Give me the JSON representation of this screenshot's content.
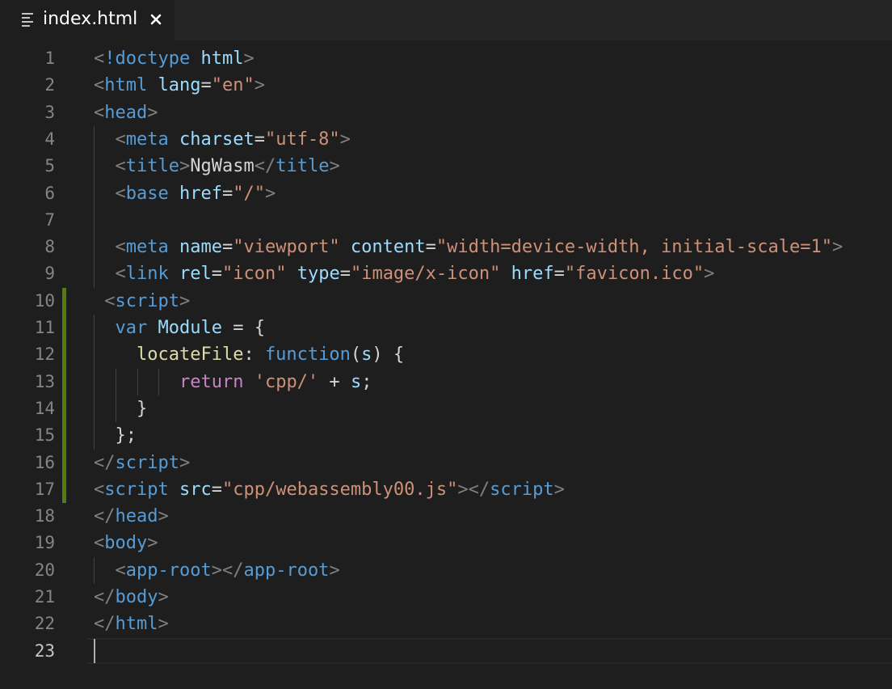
{
  "tab": {
    "label": "index.html",
    "icon": "lines-file-icon",
    "close_icon": "close-icon"
  },
  "editor": {
    "active_line": 23,
    "modified_lines": [
      10,
      11,
      12,
      13,
      14,
      15,
      16,
      17
    ],
    "lines": [
      {
        "num": "1",
        "tokens": [
          {
            "c": "punct",
            "t": "<"
          },
          {
            "c": "tag",
            "t": "!doctype"
          },
          {
            "c": "txt",
            "t": " "
          },
          {
            "c": "attr",
            "t": "html"
          },
          {
            "c": "punct",
            "t": ">"
          }
        ]
      },
      {
        "num": "2",
        "tokens": [
          {
            "c": "punct",
            "t": "<"
          },
          {
            "c": "tag",
            "t": "html"
          },
          {
            "c": "txt",
            "t": " "
          },
          {
            "c": "attr",
            "t": "lang"
          },
          {
            "c": "txt",
            "t": "="
          },
          {
            "c": "str",
            "t": "\"en\""
          },
          {
            "c": "punct",
            "t": ">"
          }
        ]
      },
      {
        "num": "3",
        "tokens": [
          {
            "c": "punct",
            "t": "<"
          },
          {
            "c": "tag",
            "t": "head"
          },
          {
            "c": "punct",
            "t": ">"
          }
        ]
      },
      {
        "num": "4",
        "tokens": [
          {
            "c": "txt",
            "t": "  "
          },
          {
            "c": "punct",
            "t": "<"
          },
          {
            "c": "tag",
            "t": "meta"
          },
          {
            "c": "txt",
            "t": " "
          },
          {
            "c": "attr",
            "t": "charset"
          },
          {
            "c": "txt",
            "t": "="
          },
          {
            "c": "str",
            "t": "\"utf-8\""
          },
          {
            "c": "punct",
            "t": ">"
          }
        ]
      },
      {
        "num": "5",
        "tokens": [
          {
            "c": "txt",
            "t": "  "
          },
          {
            "c": "punct",
            "t": "<"
          },
          {
            "c": "tag",
            "t": "title"
          },
          {
            "c": "punct",
            "t": ">"
          },
          {
            "c": "txt",
            "t": "NgWasm"
          },
          {
            "c": "punct",
            "t": "</"
          },
          {
            "c": "tag",
            "t": "title"
          },
          {
            "c": "punct",
            "t": ">"
          }
        ]
      },
      {
        "num": "6",
        "tokens": [
          {
            "c": "txt",
            "t": "  "
          },
          {
            "c": "punct",
            "t": "<"
          },
          {
            "c": "tag",
            "t": "base"
          },
          {
            "c": "txt",
            "t": " "
          },
          {
            "c": "attr",
            "t": "href"
          },
          {
            "c": "txt",
            "t": "="
          },
          {
            "c": "str",
            "t": "\"/\""
          },
          {
            "c": "punct",
            "t": ">"
          }
        ]
      },
      {
        "num": "7",
        "tokens": []
      },
      {
        "num": "8",
        "tokens": [
          {
            "c": "txt",
            "t": "  "
          },
          {
            "c": "punct",
            "t": "<"
          },
          {
            "c": "tag",
            "t": "meta"
          },
          {
            "c": "txt",
            "t": " "
          },
          {
            "c": "attr",
            "t": "name"
          },
          {
            "c": "txt",
            "t": "="
          },
          {
            "c": "str",
            "t": "\"viewport\""
          },
          {
            "c": "txt",
            "t": " "
          },
          {
            "c": "attr",
            "t": "content"
          },
          {
            "c": "txt",
            "t": "="
          },
          {
            "c": "str",
            "t": "\"width=device-width, initial-scale=1\""
          },
          {
            "c": "punct",
            "t": ">"
          }
        ]
      },
      {
        "num": "9",
        "tokens": [
          {
            "c": "txt",
            "t": "  "
          },
          {
            "c": "punct",
            "t": "<"
          },
          {
            "c": "tag",
            "t": "link"
          },
          {
            "c": "txt",
            "t": " "
          },
          {
            "c": "attr",
            "t": "rel"
          },
          {
            "c": "txt",
            "t": "="
          },
          {
            "c": "str",
            "t": "\"icon\""
          },
          {
            "c": "txt",
            "t": " "
          },
          {
            "c": "attr",
            "t": "type"
          },
          {
            "c": "txt",
            "t": "="
          },
          {
            "c": "str",
            "t": "\"image/x-icon\""
          },
          {
            "c": "txt",
            "t": " "
          },
          {
            "c": "attr",
            "t": "href"
          },
          {
            "c": "txt",
            "t": "="
          },
          {
            "c": "str",
            "t": "\"favicon.ico\""
          },
          {
            "c": "punct",
            "t": ">"
          }
        ]
      },
      {
        "num": "10",
        "tokens": [
          {
            "c": "txt",
            "t": " "
          },
          {
            "c": "punct",
            "t": "<"
          },
          {
            "c": "tag",
            "t": "script"
          },
          {
            "c": "punct",
            "t": ">"
          }
        ]
      },
      {
        "num": "11",
        "tokens": [
          {
            "c": "txt",
            "t": "  "
          },
          {
            "c": "kw",
            "t": "var"
          },
          {
            "c": "txt",
            "t": " "
          },
          {
            "c": "attr",
            "t": "Module"
          },
          {
            "c": "txt",
            "t": " = {"
          }
        ]
      },
      {
        "num": "12",
        "tokens": [
          {
            "c": "txt",
            "t": "    "
          },
          {
            "c": "fn",
            "t": "locateFile"
          },
          {
            "c": "txt",
            "t": ": "
          },
          {
            "c": "kw",
            "t": "function"
          },
          {
            "c": "txt",
            "t": "("
          },
          {
            "c": "attr",
            "t": "s"
          },
          {
            "c": "txt",
            "t": ") {"
          }
        ]
      },
      {
        "num": "13",
        "tokens": [
          {
            "c": "txt",
            "t": "        "
          },
          {
            "c": "ret",
            "t": "return"
          },
          {
            "c": "txt",
            "t": " "
          },
          {
            "c": "str",
            "t": "'cpp/'"
          },
          {
            "c": "txt",
            "t": " + "
          },
          {
            "c": "attr",
            "t": "s"
          },
          {
            "c": "txt",
            "t": ";"
          }
        ]
      },
      {
        "num": "14",
        "tokens": [
          {
            "c": "txt",
            "t": "    }"
          }
        ]
      },
      {
        "num": "15",
        "tokens": [
          {
            "c": "txt",
            "t": "  };"
          }
        ]
      },
      {
        "num": "16",
        "tokens": [
          {
            "c": "punct",
            "t": "</"
          },
          {
            "c": "tag",
            "t": "script"
          },
          {
            "c": "punct",
            "t": ">"
          }
        ]
      },
      {
        "num": "17",
        "tokens": [
          {
            "c": "punct",
            "t": "<"
          },
          {
            "c": "tag",
            "t": "script"
          },
          {
            "c": "txt",
            "t": " "
          },
          {
            "c": "attr",
            "t": "src"
          },
          {
            "c": "txt",
            "t": "="
          },
          {
            "c": "str",
            "t": "\"cpp/webassembly00.js\""
          },
          {
            "c": "punct",
            "t": "></"
          },
          {
            "c": "tag",
            "t": "script"
          },
          {
            "c": "punct",
            "t": ">"
          }
        ]
      },
      {
        "num": "18",
        "tokens": [
          {
            "c": "punct",
            "t": "</"
          },
          {
            "c": "tag",
            "t": "head"
          },
          {
            "c": "punct",
            "t": ">"
          }
        ]
      },
      {
        "num": "19",
        "tokens": [
          {
            "c": "punct",
            "t": "<"
          },
          {
            "c": "tag",
            "t": "body"
          },
          {
            "c": "punct",
            "t": ">"
          }
        ]
      },
      {
        "num": "20",
        "tokens": [
          {
            "c": "txt",
            "t": "  "
          },
          {
            "c": "punct",
            "t": "<"
          },
          {
            "c": "tag",
            "t": "app-root"
          },
          {
            "c": "punct",
            "t": "></"
          },
          {
            "c": "tag",
            "t": "app-root"
          },
          {
            "c": "punct",
            "t": ">"
          }
        ]
      },
      {
        "num": "21",
        "tokens": [
          {
            "c": "punct",
            "t": "</"
          },
          {
            "c": "tag",
            "t": "body"
          },
          {
            "c": "punct",
            "t": ">"
          }
        ]
      },
      {
        "num": "22",
        "tokens": [
          {
            "c": "punct",
            "t": "</"
          },
          {
            "c": "tag",
            "t": "html"
          },
          {
            "c": "punct",
            "t": ">"
          }
        ]
      },
      {
        "num": "23",
        "tokens": []
      }
    ]
  }
}
